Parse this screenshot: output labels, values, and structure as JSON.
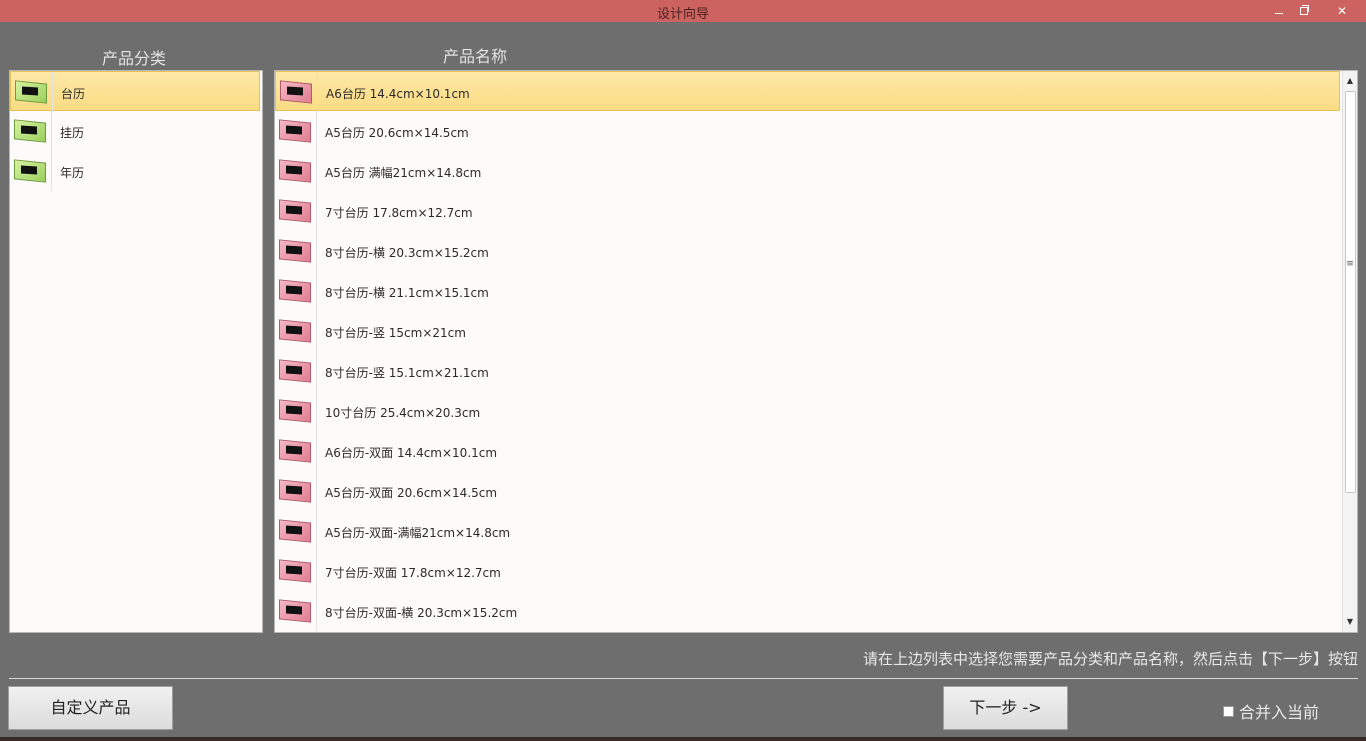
{
  "window": {
    "title": "设计向导",
    "min_glyph": "",
    "close_glyph": "✕"
  },
  "categories": {
    "header": "产品分类",
    "items": [
      {
        "label": "台历",
        "selected": true
      },
      {
        "label": "挂历",
        "selected": false
      },
      {
        "label": "年历",
        "selected": false
      }
    ]
  },
  "products": {
    "header": "产品名称",
    "items": [
      {
        "label": "A6台历 14.4cm×10.1cm",
        "selected": true
      },
      {
        "label": "A5台历 20.6cm×14.5cm"
      },
      {
        "label": "A5台历 满幅21cm×14.8cm"
      },
      {
        "label": "7寸台历 17.8cm×12.7cm"
      },
      {
        "label": "8寸台历-横 20.3cm×15.2cm"
      },
      {
        "label": "8寸台历-横 21.1cm×15.1cm"
      },
      {
        "label": "8寸台历-竖 15cm×21cm"
      },
      {
        "label": "8寸台历-竖 15.1cm×21.1cm"
      },
      {
        "label": "10寸台历 25.4cm×20.3cm"
      },
      {
        "label": "A6台历-双面 14.4cm×10.1cm"
      },
      {
        "label": "A5台历-双面 20.6cm×14.5cm"
      },
      {
        "label": "A5台历-双面-满幅21cm×14.8cm"
      },
      {
        "label": "7寸台历-双面 17.8cm×12.7cm"
      },
      {
        "label": "8寸台历-双面-横 20.3cm×15.2cm"
      }
    ]
  },
  "hint": "请在上边列表中选择您需要产品分类和产品名称，然后点击【下一步】按钮",
  "buttons": {
    "custom_product": "自定义产品",
    "next": "下一步 ->"
  },
  "merge": {
    "label": "合并入当前",
    "checked": false
  },
  "colors": {
    "title_bar": "#cd6361",
    "background": "#6e6e6e",
    "selected_row": "#fbdc84"
  },
  "icons": {
    "category": "green-calendar-frame-icon",
    "product": "pink-calendar-frame-icon"
  }
}
